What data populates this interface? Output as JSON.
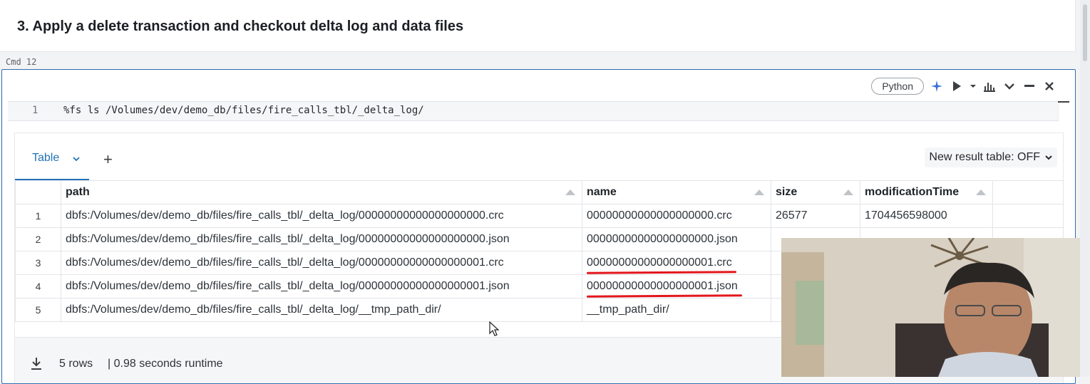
{
  "markdown": {
    "heading": "3. Apply a delete transaction and checkout delta log and data files"
  },
  "cell": {
    "cmd_label": "Cmd 12",
    "language": "Python",
    "line_number": "1",
    "code": "%fs ls /Volumes/dev/demo_db/files/fire_calls_tbl/_delta_log/",
    "toolbar_icons": [
      "sparkle-icon",
      "run-icon",
      "dropdown-icon",
      "chart-icon",
      "collapse-icon",
      "minimize-icon",
      "close-icon"
    ]
  },
  "results": {
    "tab_label": "Table",
    "add_label": "+",
    "new_result_label": "New result table: OFF",
    "columns": [
      "path",
      "name",
      "size",
      "modificationTime"
    ],
    "rows": [
      {
        "idx": "1",
        "path": "dbfs:/Volumes/dev/demo_db/files/fire_calls_tbl/_delta_log/00000000000000000000.crc",
        "name": "00000000000000000000.crc",
        "size": "26577",
        "mtime": "1704456598000"
      },
      {
        "idx": "2",
        "path": "dbfs:/Volumes/dev/demo_db/files/fire_calls_tbl/_delta_log/00000000000000000000.json",
        "name": "00000000000000000000.json",
        "size": "",
        "mtime": ""
      },
      {
        "idx": "3",
        "path": "dbfs:/Volumes/dev/demo_db/files/fire_calls_tbl/_delta_log/00000000000000000001.crc",
        "name": "00000000000000000001.crc",
        "size": "",
        "mtime": ""
      },
      {
        "idx": "4",
        "path": "dbfs:/Volumes/dev/demo_db/files/fire_calls_tbl/_delta_log/00000000000000000001.json",
        "name": "00000000000000000001.json",
        "size": "",
        "mtime": ""
      },
      {
        "idx": "5",
        "path": "dbfs:/Volumes/dev/demo_db/files/fire_calls_tbl/_delta_log/__tmp_path_dir/",
        "name": "__tmp_path_dir/",
        "size": "",
        "mtime": ""
      }
    ],
    "footer_rows": "5 rows",
    "footer_runtime": "| 0.98 seconds runtime"
  },
  "colors": {
    "accent": "#2272b4",
    "cell_border": "#2f6db1",
    "annotation": "#e3161b"
  }
}
